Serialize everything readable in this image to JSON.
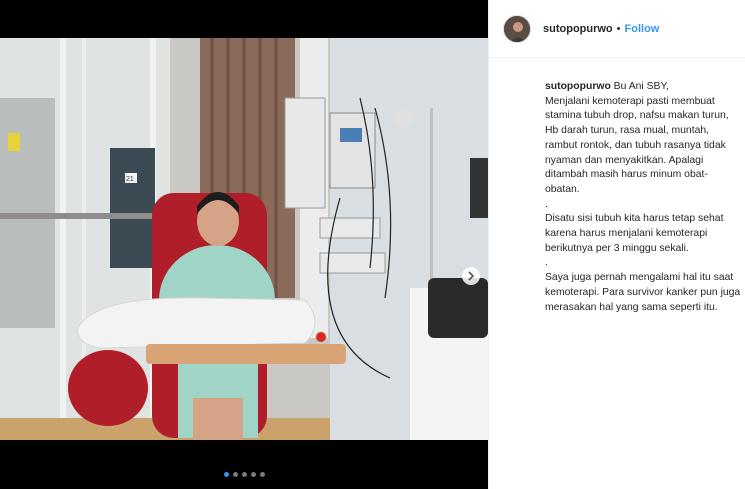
{
  "post": {
    "username": "sutopopurwo",
    "separator": "•",
    "follow_label": "Follow",
    "caption_user": "sutopopurwo",
    "caption_text": " Bu Ani SBY,\nMenjalani kemoterapi pasti membuat stamina tubuh drop, nafsu makan turun, Hb darah turun, rasa mual, muntah, rambut rontok, dan tubuh rasanya tidak nyaman dan menyakitkan. Apalagi ditambah masih harus minum obat-obatan.\n.\nDisatu sisi tubuh kita harus tetap sehat karena harus menjalani kemoterapi berikutnya per 3 minggu sekali.\n.\nSaya juga pernah mengalami hal itu saat kemoterapi. Para survivor kanker pun juga merasakan hal yang sama seperti itu."
  },
  "photo": {
    "room_number": "21"
  },
  "carousel": {
    "total": 5,
    "active_index": 0
  },
  "colors": {
    "accent": "#3897f0",
    "gown": "#9fd4c6",
    "chair": "#b01e2a"
  },
  "icons": {
    "next": "chevron-right-icon"
  }
}
